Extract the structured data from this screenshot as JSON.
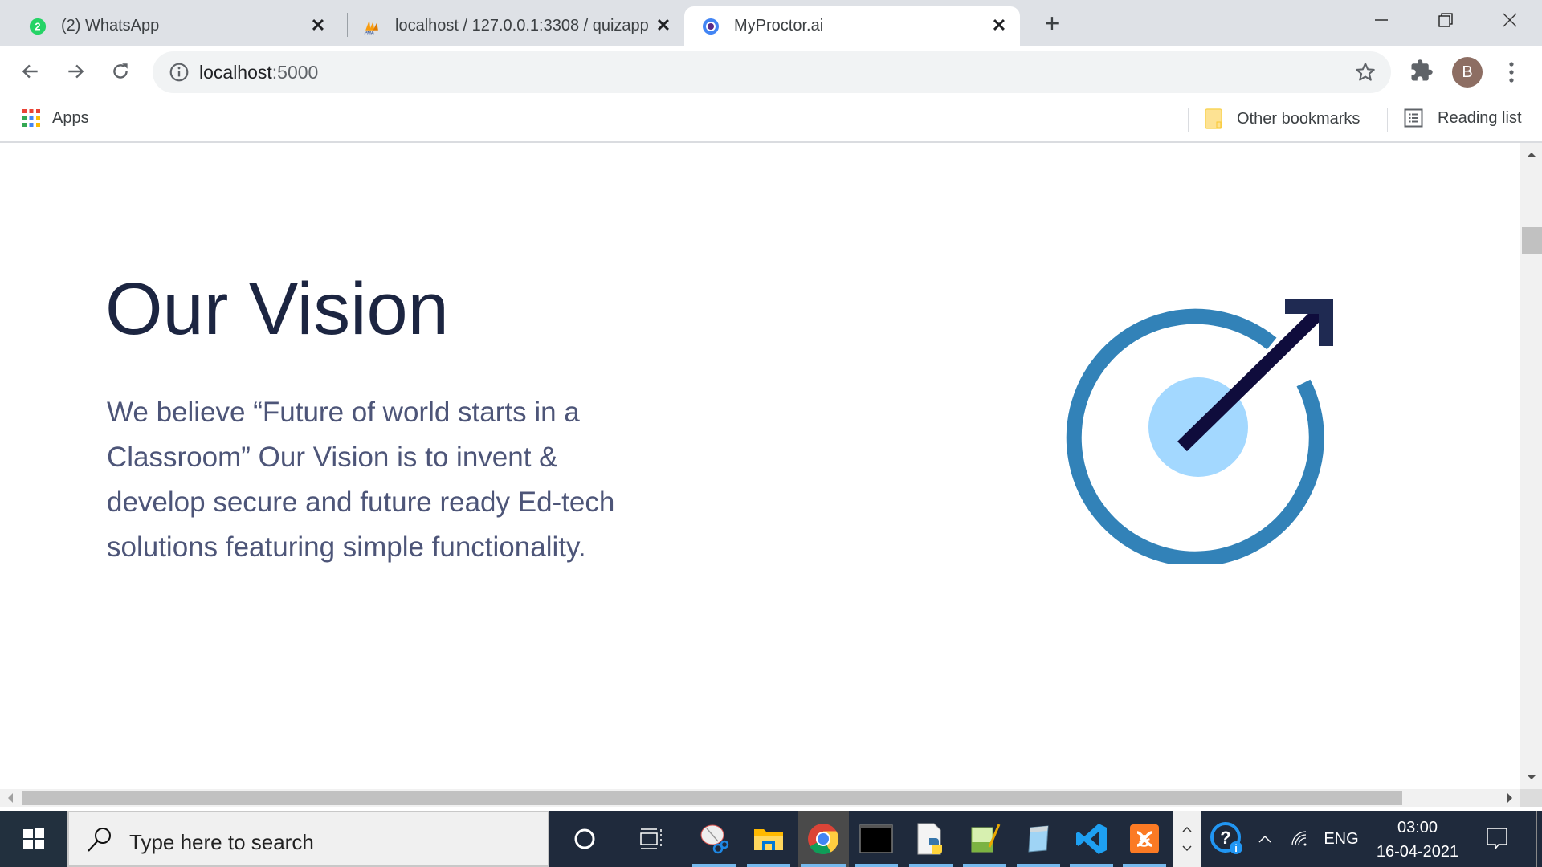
{
  "browser": {
    "tabs": [
      {
        "title": "(2) WhatsApp",
        "badge": "2",
        "icon": "whatsapp-icon",
        "active": false
      },
      {
        "title": "localhost / 127.0.0.1:3308 / quizapp",
        "icon": "phpmyadmin-icon",
        "active": false
      },
      {
        "title": "MyProctor.ai",
        "icon": "site-favicon",
        "active": true
      }
    ],
    "new_tab_label": "+",
    "close_glyph": "✕",
    "address_bar": {
      "host": "localhost",
      "port": ":5000"
    },
    "profile_initial": "B",
    "bookmarks_bar": {
      "apps_label": "Apps",
      "other_bookmarks_label": "Other bookmarks",
      "reading_list_label": "Reading list"
    }
  },
  "page": {
    "heading": "Our Vision",
    "paragraph": "We believe “Future of world starts in a Classroom” Our Vision is to invent & develop secure and future ready Ed-tech solutions featuring simple functionality.",
    "graphic": {
      "name": "target-arrow-illustration",
      "ring_color": "#3282b8",
      "center_color": "#a3d8ff",
      "arrow_color": "#0f0c3c",
      "arrowhead_color": "#1f2a52"
    }
  },
  "taskbar": {
    "search_placeholder": "Type here to search",
    "pinned_apps": [
      "cortana",
      "task-view",
      "snipping-tool",
      "file-explorer",
      "chrome",
      "terminal",
      "python-file",
      "notepad-plus-plus",
      "notepad",
      "vs-code",
      "xampp"
    ],
    "tray": {
      "language": "ENG",
      "time": "03:00",
      "date": "16-04-2021"
    }
  },
  "colors": {
    "heading": "#1c2541",
    "paragraph": "#4d5578",
    "tabstrip": "#dee1e6",
    "taskbar": "#1f2a3c"
  }
}
